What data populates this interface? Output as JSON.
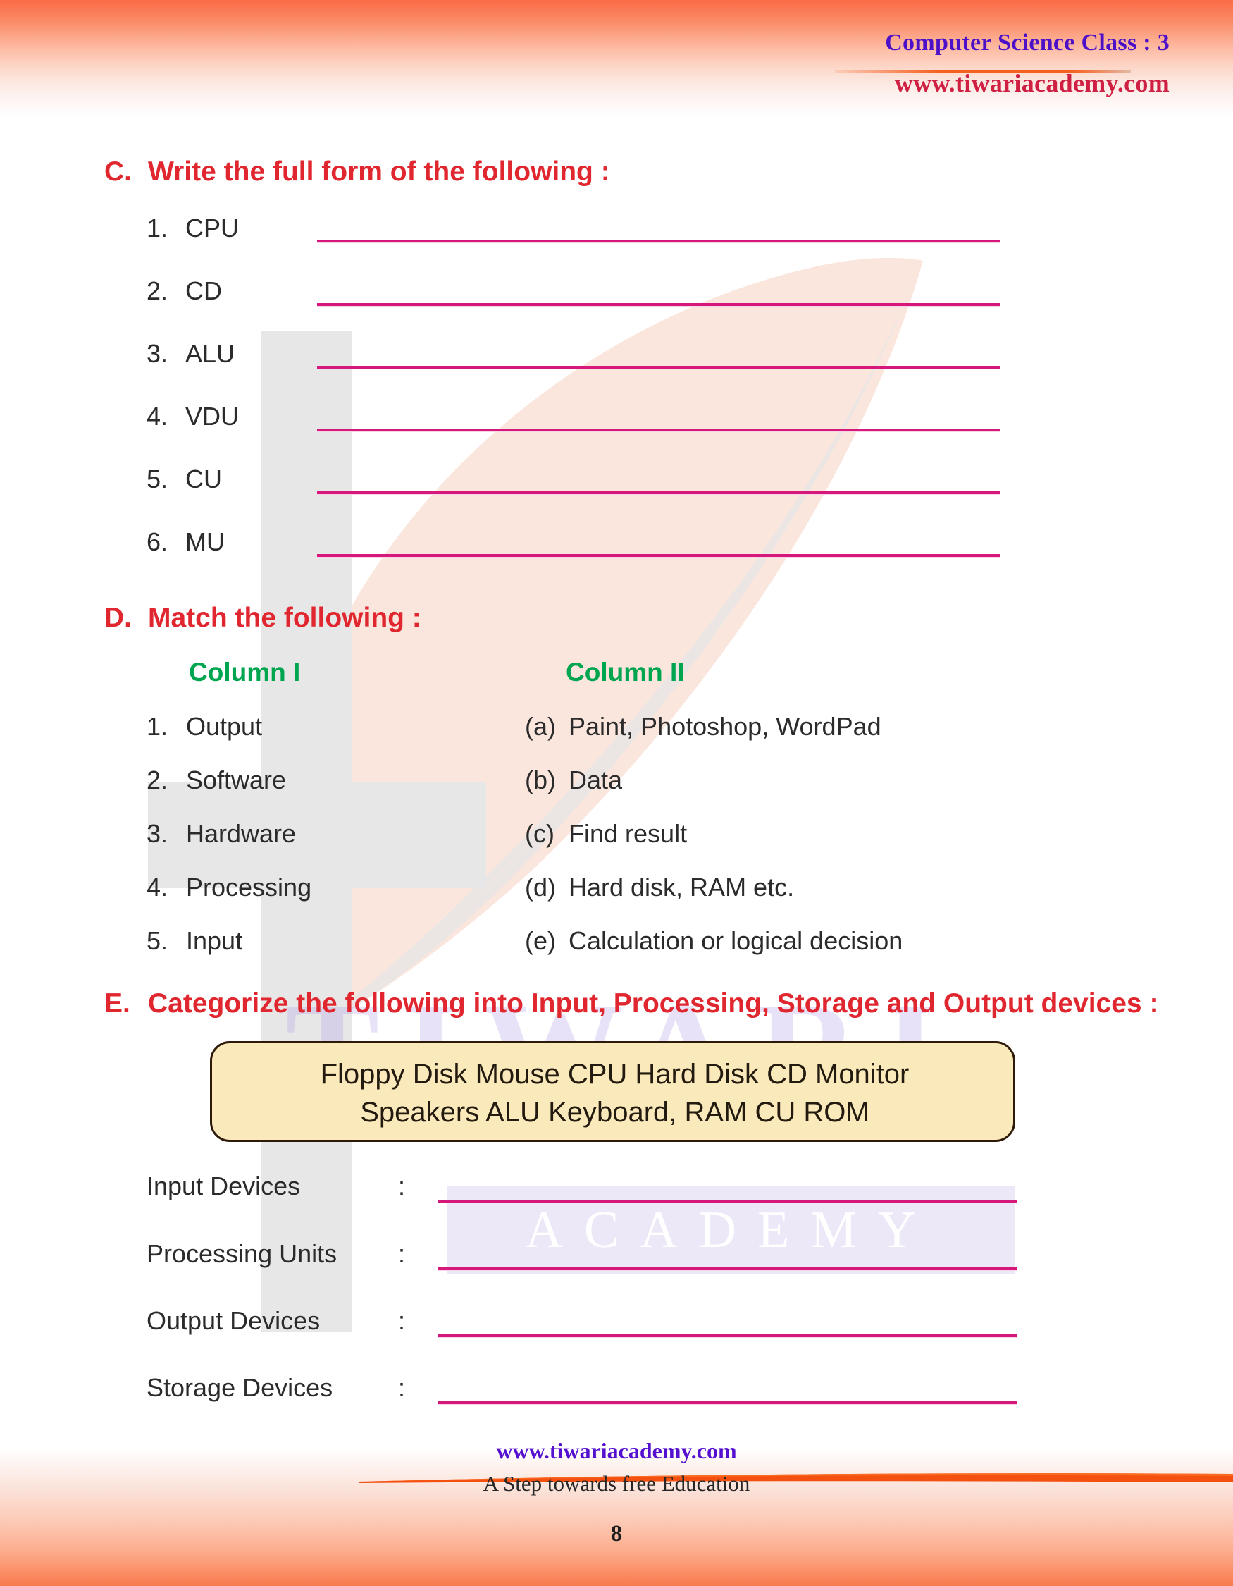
{
  "header": {
    "title": "Computer Science Class : 3",
    "site": "www.tiwariacademy.com"
  },
  "watermarks": {
    "tiwari": "TIWARI",
    "academy": "ACADEMY"
  },
  "section_c": {
    "letter": "C.",
    "title": "Write the full form of the following :",
    "items": [
      {
        "num": "1.",
        "label": "CPU"
      },
      {
        "num": "2.",
        "label": "CD"
      },
      {
        "num": "3.",
        "label": "ALU"
      },
      {
        "num": "4.",
        "label": "VDU"
      },
      {
        "num": "5.",
        "label": "CU"
      },
      {
        "num": "6.",
        "label": "MU"
      }
    ]
  },
  "section_d": {
    "letter": "D.",
    "title": "Match the following :",
    "column1_head": "Column I",
    "column2_head": "Column II",
    "column1": [
      {
        "num": "1.",
        "label": "Output"
      },
      {
        "num": "2.",
        "label": "Software"
      },
      {
        "num": "3.",
        "label": "Hardware"
      },
      {
        "num": "4.",
        "label": "Processing"
      },
      {
        "num": "5.",
        "label": "Input"
      }
    ],
    "column2": [
      {
        "letter": "(a)",
        "label": "Paint, Photoshop, WordPad"
      },
      {
        "letter": "(b)",
        "label": "Data"
      },
      {
        "letter": "(c)",
        "label": "Find result"
      },
      {
        "letter": "(d)",
        "label": "Hard disk, RAM etc."
      },
      {
        "letter": "(e)",
        "label": "Calculation or logical decision"
      }
    ]
  },
  "section_e": {
    "letter": "E.",
    "title": "Categorize the following into Input, Processing, Storage and Output devices :",
    "wordbank_line1": "Floppy Disk    Mouse    CPU    Hard Disk    CD    Monitor",
    "wordbank_line2": "Speakers    ALU    Keyboard, RAM    CU    ROM",
    "categories": [
      {
        "label": "Input Devices",
        "colon": ":"
      },
      {
        "label": "Processing Units",
        "colon": ":"
      },
      {
        "label": "Output Devices",
        "colon": ":"
      },
      {
        "label": "Storage Devices",
        "colon": ":"
      }
    ]
  },
  "footer": {
    "site": "www.tiwariacademy.com",
    "tagline": "A Step towards free Education",
    "page_number": "8"
  },
  "colors": {
    "heading_red": "#e0272f",
    "column_green": "#00a550",
    "answer_line": "#d6187c",
    "header_purple": "#4b10c8",
    "header_crimson": "#cf1f43",
    "band_orange": "#f96b46",
    "wordbox_fill": "#fae9ba"
  }
}
